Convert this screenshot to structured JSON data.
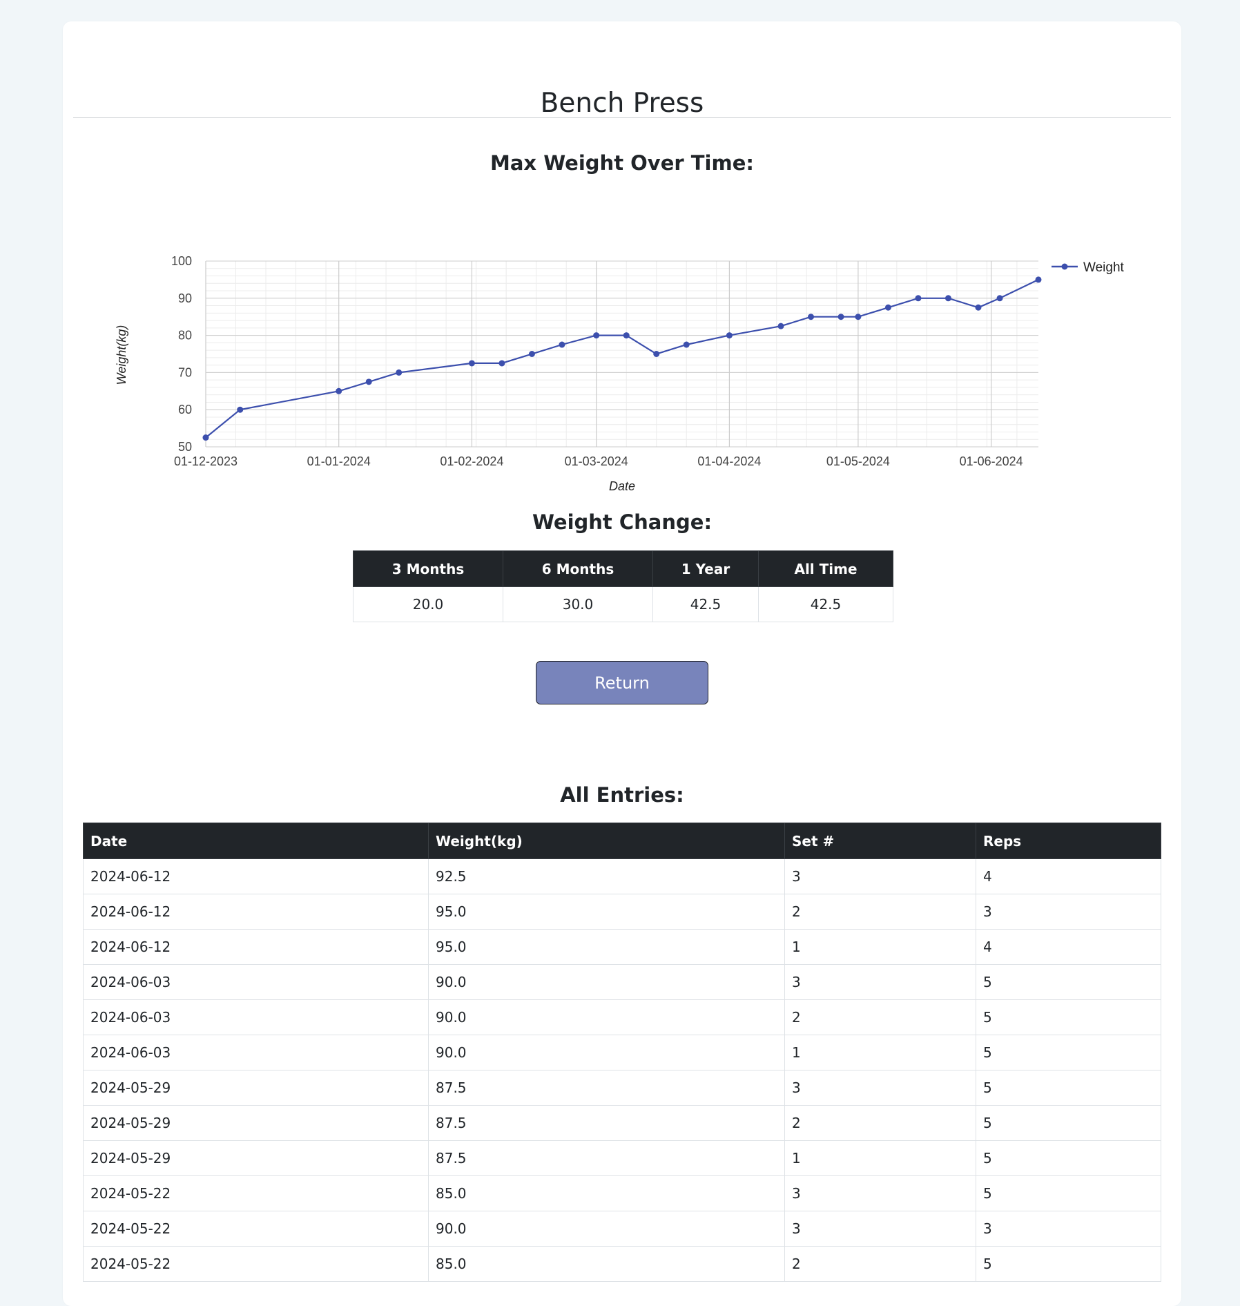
{
  "page": {
    "title": "Bench Press"
  },
  "chart_section": {
    "heading": "Max Weight Over Time:"
  },
  "chart_data": {
    "type": "line",
    "title": "",
    "xlabel": "Date",
    "ylabel": "Weight(kg)",
    "ylim": [
      50,
      100
    ],
    "xlim": [
      "2023-12-01",
      "2024-06-12"
    ],
    "yticks": [
      50,
      60,
      70,
      80,
      90,
      100
    ],
    "xticks": [
      {
        "date": "2023-12-01",
        "label": "01-12-2023"
      },
      {
        "date": "2024-01-01",
        "label": "01-01-2024"
      },
      {
        "date": "2024-02-01",
        "label": "01-02-2024"
      },
      {
        "date": "2024-03-01",
        "label": "01-03-2024"
      },
      {
        "date": "2024-04-01",
        "label": "01-04-2024"
      },
      {
        "date": "2024-05-01",
        "label": "01-05-2024"
      },
      {
        "date": "2024-06-01",
        "label": "01-06-2024"
      }
    ],
    "grid": true,
    "legend": "top-right",
    "color": "#3c4fad",
    "series": [
      {
        "name": "Weight",
        "points": [
          {
            "x": "2023-12-01",
            "y": 52.5
          },
          {
            "x": "2023-12-09",
            "y": 60
          },
          {
            "x": "2024-01-01",
            "y": 65
          },
          {
            "x": "2024-01-08",
            "y": 67.5
          },
          {
            "x": "2024-01-15",
            "y": 70
          },
          {
            "x": "2024-02-01",
            "y": 72.5
          },
          {
            "x": "2024-02-08",
            "y": 72.5
          },
          {
            "x": "2024-02-15",
            "y": 75
          },
          {
            "x": "2024-02-22",
            "y": 77.5
          },
          {
            "x": "2024-03-01",
            "y": 80
          },
          {
            "x": "2024-03-08",
            "y": 80
          },
          {
            "x": "2024-03-15",
            "y": 75
          },
          {
            "x": "2024-03-22",
            "y": 77.5
          },
          {
            "x": "2024-04-01",
            "y": 80
          },
          {
            "x": "2024-04-13",
            "y": 82.5
          },
          {
            "x": "2024-04-20",
            "y": 85
          },
          {
            "x": "2024-04-27",
            "y": 85
          },
          {
            "x": "2024-05-01",
            "y": 85
          },
          {
            "x": "2024-05-08",
            "y": 87.5
          },
          {
            "x": "2024-05-15",
            "y": 90
          },
          {
            "x": "2024-05-22",
            "y": 90
          },
          {
            "x": "2024-05-29",
            "y": 87.5
          },
          {
            "x": "2024-06-03",
            "y": 90
          },
          {
            "x": "2024-06-12",
            "y": 95
          }
        ]
      }
    ]
  },
  "weight_change": {
    "heading": "Weight Change:",
    "headers": [
      "3 Months",
      "6 Months",
      "1 Year",
      "All Time"
    ],
    "values": [
      "20.0",
      "30.0",
      "42.5",
      "42.5"
    ]
  },
  "return_button": {
    "label": "Return"
  },
  "entries": {
    "heading": "All Entries:",
    "headers": [
      "Date",
      "Weight(kg)",
      "Set #",
      "Reps"
    ],
    "rows": [
      [
        "2024-06-12",
        "92.5",
        "3",
        "4"
      ],
      [
        "2024-06-12",
        "95.0",
        "2",
        "3"
      ],
      [
        "2024-06-12",
        "95.0",
        "1",
        "4"
      ],
      [
        "2024-06-03",
        "90.0",
        "3",
        "5"
      ],
      [
        "2024-06-03",
        "90.0",
        "2",
        "5"
      ],
      [
        "2024-06-03",
        "90.0",
        "1",
        "5"
      ],
      [
        "2024-05-29",
        "87.5",
        "3",
        "5"
      ],
      [
        "2024-05-29",
        "87.5",
        "2",
        "5"
      ],
      [
        "2024-05-29",
        "87.5",
        "1",
        "5"
      ],
      [
        "2024-05-22",
        "85.0",
        "3",
        "5"
      ],
      [
        "2024-05-22",
        "90.0",
        "3",
        "3"
      ],
      [
        "2024-05-22",
        "85.0",
        "2",
        "5"
      ]
    ]
  }
}
